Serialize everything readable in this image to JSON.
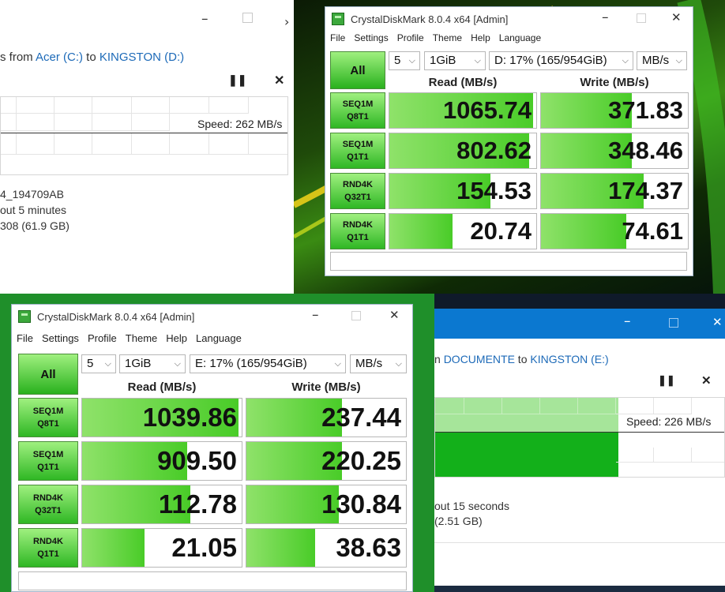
{
  "copy1": {
    "subtitle_prefix": "s from ",
    "source": "Acer (C:)",
    "to_word": " to ",
    "target": "KINGSTON (D:)",
    "speed": "Speed: 262 MB/s",
    "name": "4_194709AB",
    "time_left": "out 5 minutes",
    "items_left": "308 (61.9 GB)",
    "pause_icon": "pause-icon",
    "close_icon": "close-icon",
    "graph_fill_fraction": 0
  },
  "cdm1": {
    "title": "CrystalDiskMark 8.0.4 x64 [Admin]",
    "menu": [
      "File",
      "Settings",
      "Profile",
      "Theme",
      "Help",
      "Language"
    ],
    "all_label": "All",
    "count": "5",
    "size": "1GiB",
    "drive": "D: 17% (165/954GiB)",
    "unit": "MB/s",
    "read_header": "Read (MB/s)",
    "write_header": "Write (MB/s)",
    "rows": [
      {
        "l1": "SEQ1M",
        "l2": "Q8T1",
        "read": "1065.74",
        "write": "371.83",
        "read_fill": 0.98,
        "write_fill": 0.62
      },
      {
        "l1": "SEQ1M",
        "l2": "Q1T1",
        "read": "802.62",
        "write": "348.46",
        "read_fill": 0.95,
        "write_fill": 0.62
      },
      {
        "l1": "RND4K",
        "l2": "Q32T1",
        "read": "154.53",
        "write": "174.37",
        "read_fill": 0.69,
        "write_fill": 0.7
      },
      {
        "l1": "RND4K",
        "l2": "Q1T1",
        "read": "20.74",
        "write": "74.61",
        "read_fill": 0.43,
        "write_fill": 0.58
      }
    ]
  },
  "cdm2": {
    "title": "CrystalDiskMark 8.0.4 x64 [Admin]",
    "menu": [
      "File",
      "Settings",
      "Profile",
      "Theme",
      "Help",
      "Language"
    ],
    "all_label": "All",
    "count": "5",
    "size": "1GiB",
    "drive": "E: 17% (165/954GiB)",
    "unit": "MB/s",
    "read_header": "Read (MB/s)",
    "write_header": "Write (MB/s)",
    "rows": [
      {
        "l1": "SEQ1M",
        "l2": "Q8T1",
        "read": "1039.86",
        "write": "237.44",
        "read_fill": 0.98,
        "write_fill": 0.6
      },
      {
        "l1": "SEQ1M",
        "l2": "Q1T1",
        "read": "909.50",
        "write": "220.25",
        "read_fill": 0.66,
        "write_fill": 0.6
      },
      {
        "l1": "RND4K",
        "l2": "Q32T1",
        "read": "112.78",
        "write": "130.84",
        "read_fill": 0.68,
        "write_fill": 0.58
      },
      {
        "l1": "RND4K",
        "l2": "Q1T1",
        "read": "21.05",
        "write": "38.63",
        "read_fill": 0.39,
        "write_fill": 0.43
      }
    ]
  },
  "copy2": {
    "subtitle_prefix": "n ",
    "source": "DOCUMENTE",
    "to_word": " to ",
    "target": "KINGSTON (E:)",
    "speed": "Speed: 226 MB/s",
    "time_left": "out 15 seconds",
    "items_left": "(2.51 GB)",
    "graph_fill_fraction": 0.63
  },
  "colors": {
    "cdm_green": "#49cc28",
    "link_blue": "#1d6ab8",
    "titlebar_blue": "#0b78d0",
    "desktop_green": "#1e8f2a"
  }
}
